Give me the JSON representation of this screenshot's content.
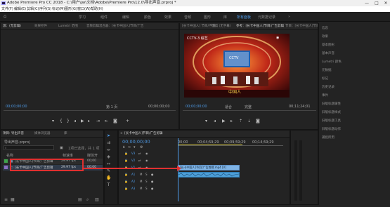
{
  "window": {
    "title": "Adobe Premiere Pro CC 2018 - C:\\用户\\jw\\文档\\Adobe\\Premiere Pro\\12.0\\导出声音.prproj *",
    "minimize": "—",
    "maximize": "□",
    "close": "✕"
  },
  "menu": [
    "文件(F)",
    "编辑(E)",
    "剪辑(C)",
    "序列(S)",
    "标记(M)",
    "图形(G)",
    "窗口(W)",
    "帮助(H)"
  ],
  "workspaces": {
    "tabs": [
      "学习",
      "组件",
      "编辑",
      "颜色",
      "效果",
      "音频",
      "图形",
      "库",
      "所有面板",
      "元数据记录"
    ],
    "active_index": 8
  },
  "source_panel": {
    "tabs": [
      "源：(无剪辑)",
      "效果控件",
      "Lumetri 范围",
      "音频剪辑混合器：[长卡中国人]节目/广告"
    ],
    "timecode_left": "00;00;00;00",
    "page": "第 1 页",
    "timecode_right": "00;00;00;00"
  },
  "program_panel": {
    "tabs": [
      "[长卡中国人] 节目/广告剪",
      "字幕：(无字幕)",
      "参考：[长卡中国人]节目/广告剪辑",
      "节目：[长卡中国人]节目/广告剪辑"
    ],
    "timecode_left": "00;00;00;00",
    "fit": "适合",
    "quality": "完整",
    "timecode_right": "00;11;24;01",
    "watermark": "CCTV-3 综艺",
    "stage_title": "中国人",
    "screen_mark": "CCTV"
  },
  "right_panel": {
    "items": [
      "信息",
      "效果",
      "基本图形",
      "基本声音",
      "Lumetri 颜色",
      "元数据",
      "标记",
      "历史记录",
      "事件",
      "旧版标题属性",
      "旧版标题样式",
      "旧版标题工具",
      "旧版标题动作",
      "捕捉所用"
    ]
  },
  "project_panel": {
    "tabs": [
      "项目: 导出声音",
      "媒体浏览器",
      "库"
    ],
    "filename": "导出声音.prproj",
    "selection": "1项已选择，共 1 项",
    "columns": [
      "名称",
      "帧速率",
      "媒体开"
    ],
    "rows": [
      {
        "name": "[长卡中国人]节目/广告剪辑",
        "rate": "29.97 fps",
        "start": "00;00"
      },
      {
        "name": "[长卡中国人]节目/广告剪辑",
        "rate": "29.97 fps",
        "start": "00;00"
      }
    ]
  },
  "timeline": {
    "tab": "[长卡中国人]节目/广告剪辑",
    "timecode": "00;00;00;00",
    "ruler": [
      "00;00",
      "00;04;59;29",
      "00;09;59;29",
      "00;14;59;29"
    ],
    "tracks": [
      "V3",
      "V2",
      "V1",
      "A1",
      "A2",
      "A3"
    ],
    "clip_label": "[长卡中国人]节目/广告剪辑.mp4 [V]"
  },
  "colors": {
    "accent": "#4e9be8",
    "highlight": "#e03030",
    "clip_video": "#7fb4e6",
    "clip_audio": "#4d9fd8"
  }
}
